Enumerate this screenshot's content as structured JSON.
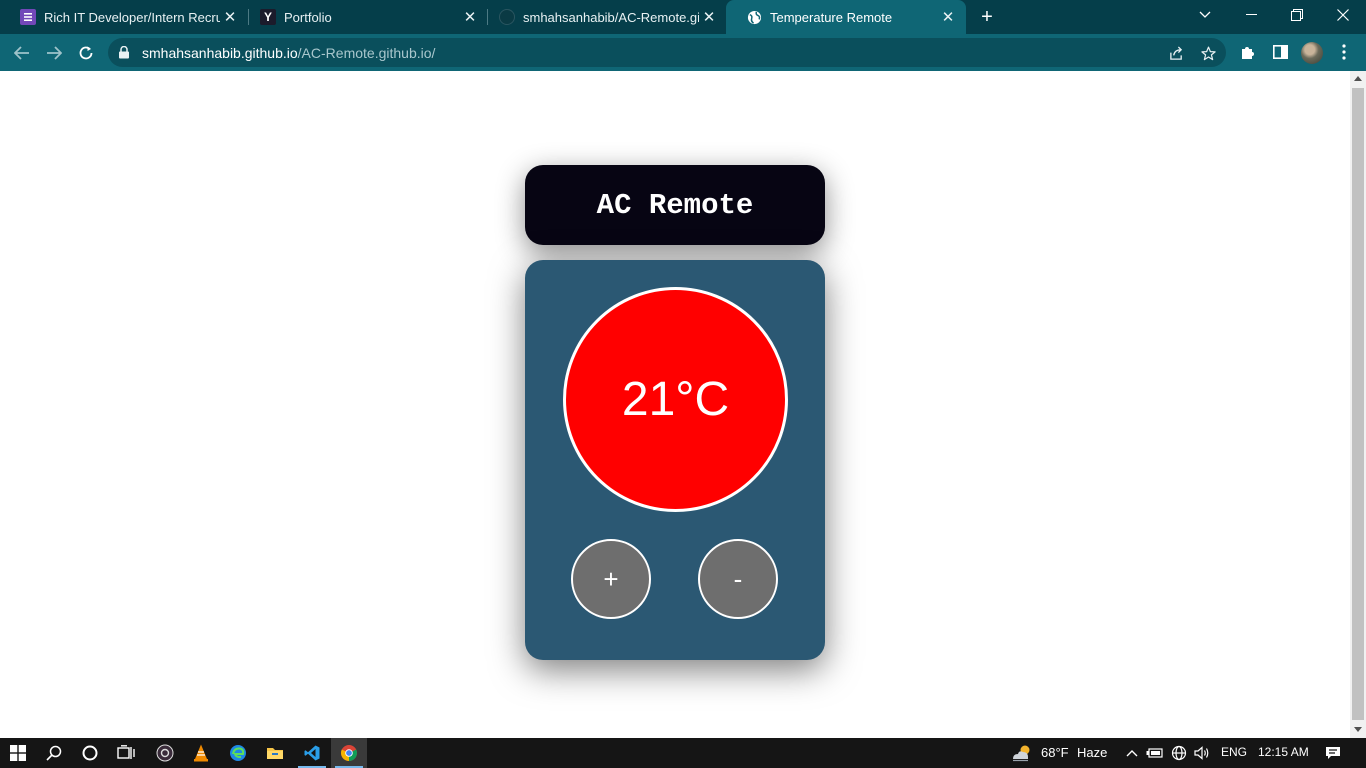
{
  "browser": {
    "tabs": [
      {
        "title": "Rich IT Developer/Intern Recruitm",
        "favicon": "form-icon",
        "active": false
      },
      {
        "title": "Portfolio",
        "favicon": "y-logo-icon",
        "active": false
      },
      {
        "title": "smhahsanhabib/AC-Remote.github",
        "favicon": "github-icon",
        "active": false
      },
      {
        "title": "Temperature Remote",
        "favicon": "globe-icon",
        "active": true
      }
    ],
    "url_host": "smhahsanhabib.github.io",
    "url_path": "/AC-Remote.github.io/"
  },
  "page": {
    "header_title": "AC Remote",
    "temperature": "21°C",
    "increase_label": "+",
    "decrease_label": "-",
    "colors": {
      "header_bg": "#070513",
      "panel_bg": "#2b5873",
      "temp_circle": "#ff0000",
      "button_bg": "#6e6e6e"
    }
  },
  "taskbar": {
    "weather_temp": "68°F",
    "weather_desc": "Haze",
    "language": "ENG",
    "time": "12:15 AM"
  }
}
